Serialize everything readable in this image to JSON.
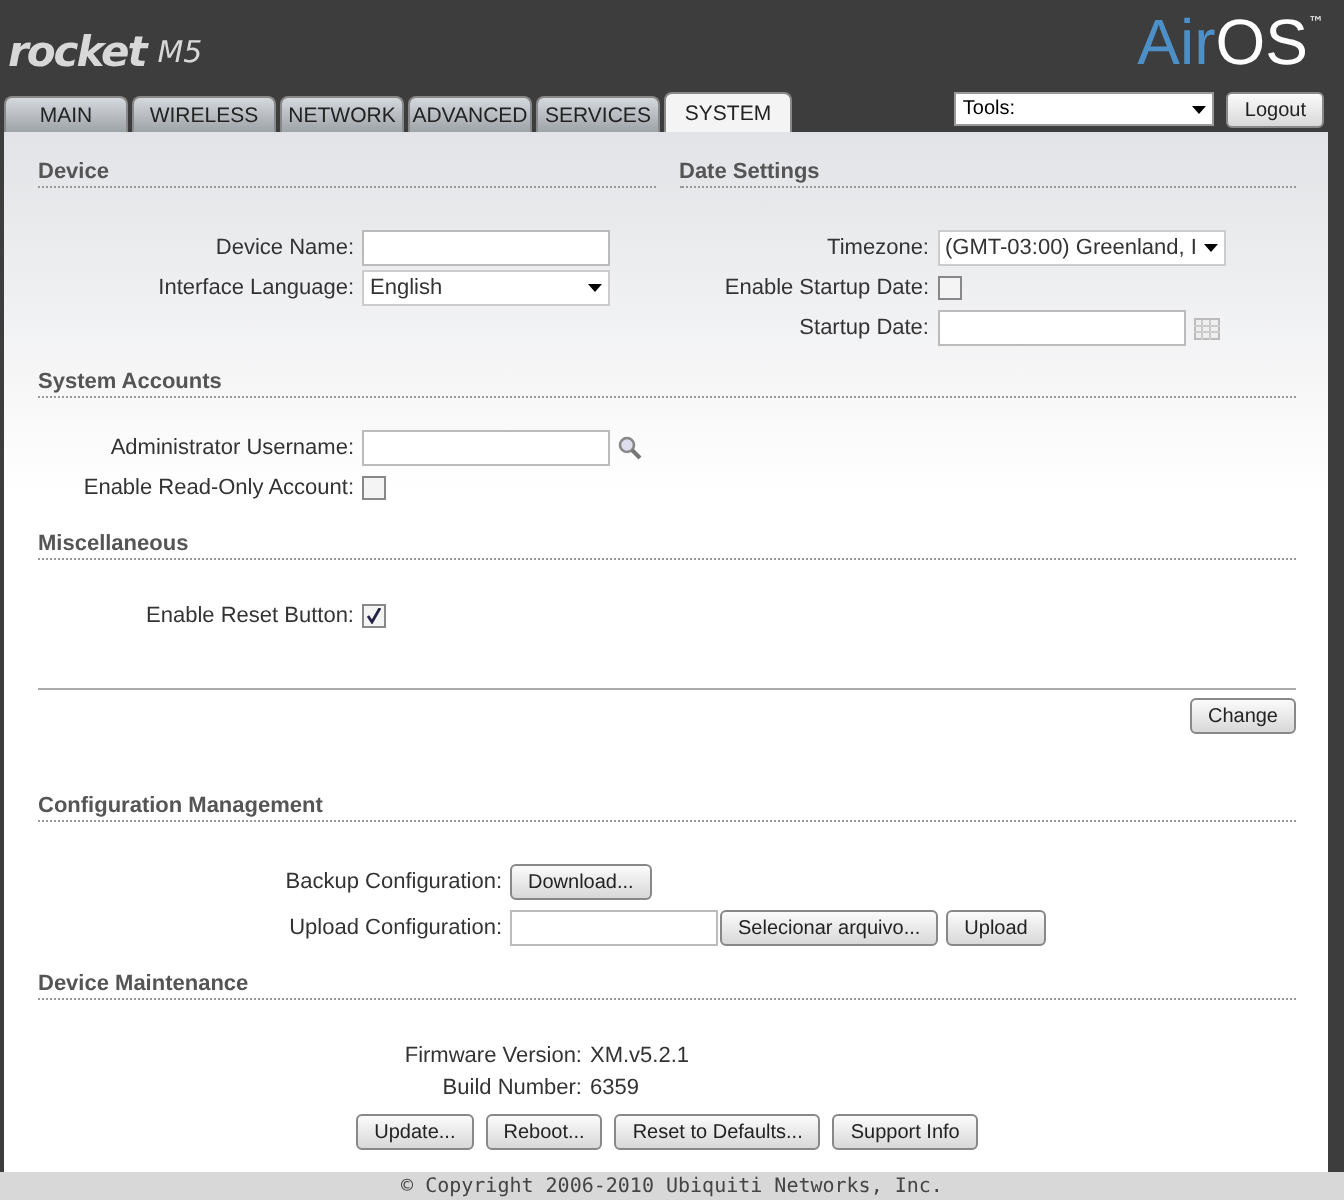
{
  "header": {
    "product": "rocket",
    "model": "M5",
    "brand_left": "Air",
    "brand_right": "OS",
    "trademark": "™"
  },
  "tabs": [
    {
      "label": "MAIN",
      "selected": false
    },
    {
      "label": "WIRELESS",
      "selected": false
    },
    {
      "label": "NETWORK",
      "selected": false
    },
    {
      "label": "ADVANCED",
      "selected": false
    },
    {
      "label": "SERVICES",
      "selected": false
    },
    {
      "label": "SYSTEM",
      "selected": true
    }
  ],
  "tools": {
    "value": "Tools:"
  },
  "logout": "Logout",
  "device": {
    "title": "Device",
    "rows": [
      {
        "kind": "text",
        "label": "Device Name:"
      },
      {
        "kind": "select",
        "label": "Interface Language:",
        "value": "English"
      }
    ]
  },
  "date_settings": {
    "title": "Date Settings",
    "rows": [
      {
        "kind": "select",
        "label": "Timezone:",
        "value": "(GMT-03:00) Greenland, I"
      },
      {
        "kind": "checkbox",
        "label": "Enable Startup Date:",
        "checked": false
      },
      {
        "kind": "date",
        "label": "Startup Date:"
      }
    ]
  },
  "system_accounts": {
    "title": "System Accounts",
    "rows": [
      {
        "kind": "search",
        "label": "Administrator Username:"
      },
      {
        "kind": "checkbox",
        "label": "Enable Read-Only Account:",
        "checked": false
      }
    ]
  },
  "miscellaneous": {
    "title": "Miscellaneous",
    "rows": [
      {
        "kind": "checkbox",
        "label": "Enable Reset Button:",
        "checked": true
      }
    ]
  },
  "change": "Change",
  "configuration": {
    "title": "Configuration Management",
    "backup_label": "Backup Configuration:",
    "download": "Download...",
    "upload_label": "Upload Configuration:",
    "choose_file": "Selecionar arquivo...",
    "upload": "Upload"
  },
  "maintenance": {
    "title": "Device Maintenance",
    "info": [
      {
        "label": "Firmware Version:",
        "value": "XM.v5.2.1"
      },
      {
        "label": "Build Number:",
        "value": "6359"
      }
    ],
    "buttons": [
      "Update...",
      "Reboot...",
      "Reset to Defaults...",
      "Support Info"
    ]
  },
  "footer": "© Copyright 2006-2010 Ubiquiti Networks, Inc."
}
